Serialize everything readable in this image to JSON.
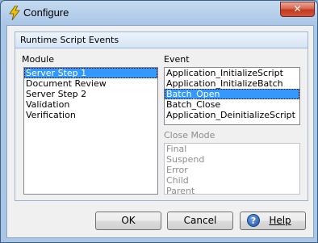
{
  "window": {
    "title": "Configure",
    "close_glyph": "✕",
    "app_icon": "lightning-bolt-icon"
  },
  "group": {
    "title": "Runtime Script Events",
    "module": {
      "label": "Module",
      "items": [
        "Server Step 1",
        "Document Review",
        "Server Step 2",
        "Validation",
        "Verification"
      ],
      "selected": "Server Step 1"
    },
    "event": {
      "label": "Event",
      "items": [
        "Application_InitializeScript",
        "Application_InitializeBatch",
        "Batch_Open",
        "Batch_Close",
        "Application_DeinitializeScript"
      ],
      "selected": "Batch_Open"
    },
    "close_mode": {
      "label": "Close Mode",
      "items": [
        "Final",
        "Suspend",
        "Error",
        "Child",
        "Parent"
      ],
      "disabled": true
    }
  },
  "buttons": {
    "ok": "OK",
    "cancel": "Cancel",
    "help": "Help",
    "help_icon_glyph": "?"
  }
}
